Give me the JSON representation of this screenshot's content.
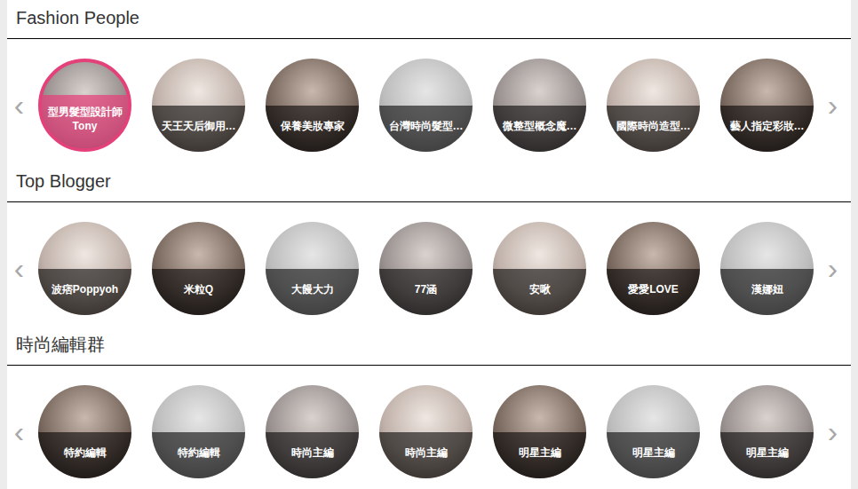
{
  "sections": [
    {
      "title": "Fashion People",
      "prev": "‹",
      "next": "›",
      "people": [
        {
          "label": "型男髮型設計師 Tony",
          "selected": true
        },
        {
          "label": "天王天后御用…",
          "selected": false
        },
        {
          "label": "保養美妝專家",
          "selected": false
        },
        {
          "label": "台灣時尚髮型…",
          "selected": false
        },
        {
          "label": "微整型概念魔…",
          "selected": false
        },
        {
          "label": "國際時尚造型…",
          "selected": false
        },
        {
          "label": "藝人指定彩妝…",
          "selected": false
        }
      ]
    },
    {
      "title": "Top Blogger",
      "prev": "‹",
      "next": "›",
      "people": [
        {
          "label": "波痞Poppyoh",
          "selected": false
        },
        {
          "label": "米粒Q",
          "selected": false
        },
        {
          "label": "大饅大力",
          "selected": false
        },
        {
          "label": "77涵",
          "selected": false
        },
        {
          "label": "安啾",
          "selected": false
        },
        {
          "label": "愛愛LOVE",
          "selected": false
        },
        {
          "label": "漢娜妞",
          "selected": false
        }
      ]
    },
    {
      "title": "時尚編輯群",
      "prev": "‹",
      "next": "›",
      "people": [
        {
          "label": "特約編輯",
          "selected": false
        },
        {
          "label": "特約編輯",
          "selected": false
        },
        {
          "label": "時尚主編",
          "selected": false
        },
        {
          "label": "時尚主編",
          "selected": false
        },
        {
          "label": "明星主編",
          "selected": false
        },
        {
          "label": "明星主編",
          "selected": false
        },
        {
          "label": "明星主編",
          "selected": false
        }
      ]
    }
  ]
}
